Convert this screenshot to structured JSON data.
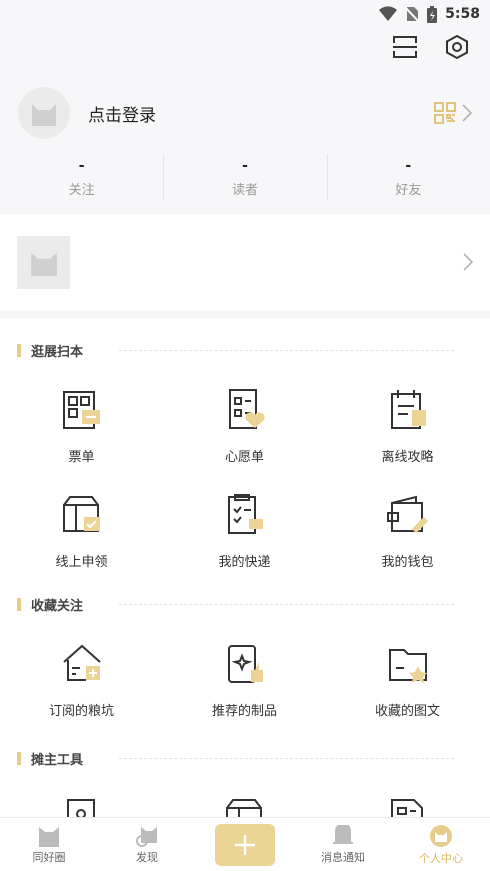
{
  "status": {
    "time": "5:58"
  },
  "profile": {
    "login_label": "点击登录"
  },
  "stats": [
    {
      "value": "-",
      "label": "关注"
    },
    {
      "value": "-",
      "label": "读者"
    },
    {
      "value": "-",
      "label": "好友"
    }
  ],
  "sections": [
    {
      "title": "逛展扫本",
      "items": [
        "票单",
        "心愿单",
        "离线攻略",
        "线上申领",
        "我的快递",
        "我的钱包"
      ]
    },
    {
      "title": "收藏关注",
      "items": [
        "订阅的粮坑",
        "推荐的制品",
        "收藏的图文"
      ]
    },
    {
      "title": "摊主工具"
    }
  ],
  "tabs": [
    "同好圈",
    "发现",
    "消息通知",
    "个人中心"
  ],
  "colors": {
    "accent": "#e7cd8b",
    "accent_text": "#d9b867"
  }
}
